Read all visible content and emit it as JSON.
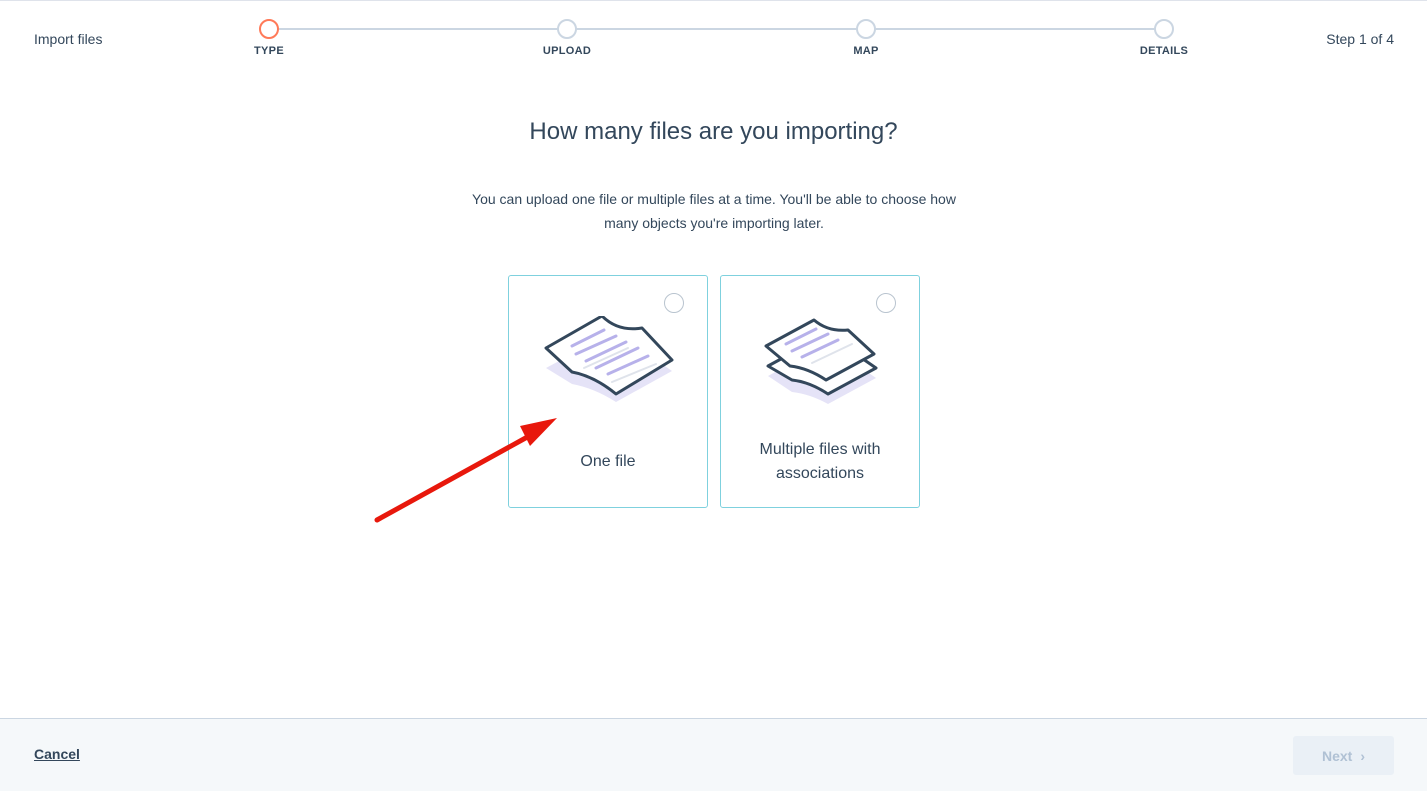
{
  "header": {
    "title": "Import files",
    "step_count": "Step 1 of 4"
  },
  "stepper": {
    "steps": [
      {
        "label": "TYPE",
        "state": "active"
      },
      {
        "label": "UPLOAD",
        "state": "pending"
      },
      {
        "label": "MAP",
        "state": "pending"
      },
      {
        "label": "DETAILS",
        "state": "pending"
      }
    ]
  },
  "main": {
    "heading": "How many files are you importing?",
    "subtext": "You can upload one file or multiple files at a time. You'll be able to choose how many objects you're importing later.",
    "options": [
      {
        "label": "One file",
        "icon": "single-file-icon",
        "selected": false
      },
      {
        "label": "Multiple files with associations",
        "icon": "multiple-files-icon",
        "selected": false
      }
    ]
  },
  "footer": {
    "cancel_label": "Cancel",
    "next_label": "Next",
    "next_icon": "chevron-right-icon"
  },
  "colors": {
    "accent": "#ff7a59",
    "card_border": "#7fd1de",
    "text": "#33475b",
    "annotation_arrow": "#e8180c"
  }
}
